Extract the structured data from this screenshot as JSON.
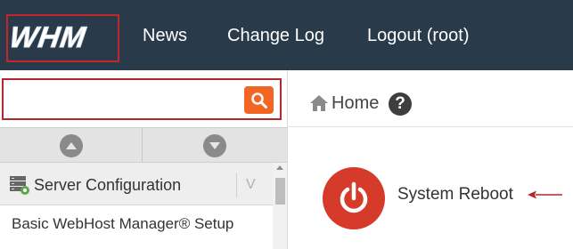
{
  "brand": {
    "logo_text": "WHM"
  },
  "topnav": {
    "news": "News",
    "changelog": "Change Log",
    "logout": "Logout (root)"
  },
  "search": {
    "value": "",
    "placeholder": ""
  },
  "breadcrumb": {
    "home": "Home",
    "help": "?"
  },
  "sidebar": {
    "section_title": "Server Configuration",
    "collapse_glyph": "V",
    "items": [
      {
        "label": "Basic WebHost Manager® Setup"
      }
    ]
  },
  "main": {
    "feature_label": "System Reboot"
  },
  "colors": {
    "topbar": "#293a4a",
    "highlight": "#c0262a",
    "search_button": "#f26522",
    "power_icon": "#d53a2a"
  }
}
